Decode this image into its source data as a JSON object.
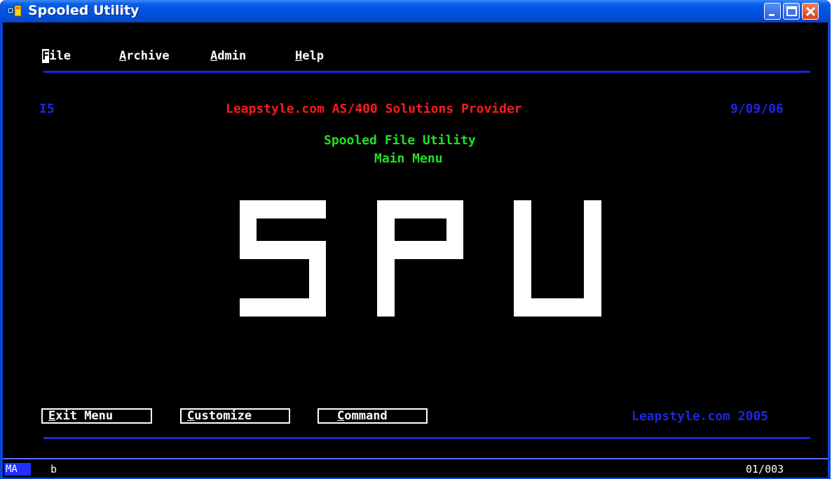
{
  "window": {
    "title": "Spooled Utility"
  },
  "menu": {
    "items": [
      {
        "first": "F",
        "rest": "ile"
      },
      {
        "first": "A",
        "rest": "rchive"
      },
      {
        "first": "A",
        "rest": "dmin"
      },
      {
        "first": "H",
        "rest": "elp"
      }
    ]
  },
  "header": {
    "system": "I5",
    "company": "Leapstyle.com AS/400 Solutions Provider",
    "date": "9/09/06"
  },
  "app": {
    "title": "Spooled File Utility",
    "subtitle": "Main Menu",
    "banner": "SPU"
  },
  "function_keys": [
    {
      "first": "E",
      "rest": "xit Menu"
    },
    {
      "first": "C",
      "rest": "ustomize"
    },
    {
      "first": "C",
      "rest": "ommand"
    }
  ],
  "footer": {
    "copyright": "Leapstyle.com 2005"
  },
  "status": {
    "mode": "MA",
    "indicator": "b",
    "cursor_position": "01/003"
  },
  "colors": {
    "screen_bg": "#000000",
    "rule": "#1c26d8",
    "green_text": "#22e022",
    "red_text": "#ff1a1a",
    "blue_text": "#1c26e8"
  }
}
